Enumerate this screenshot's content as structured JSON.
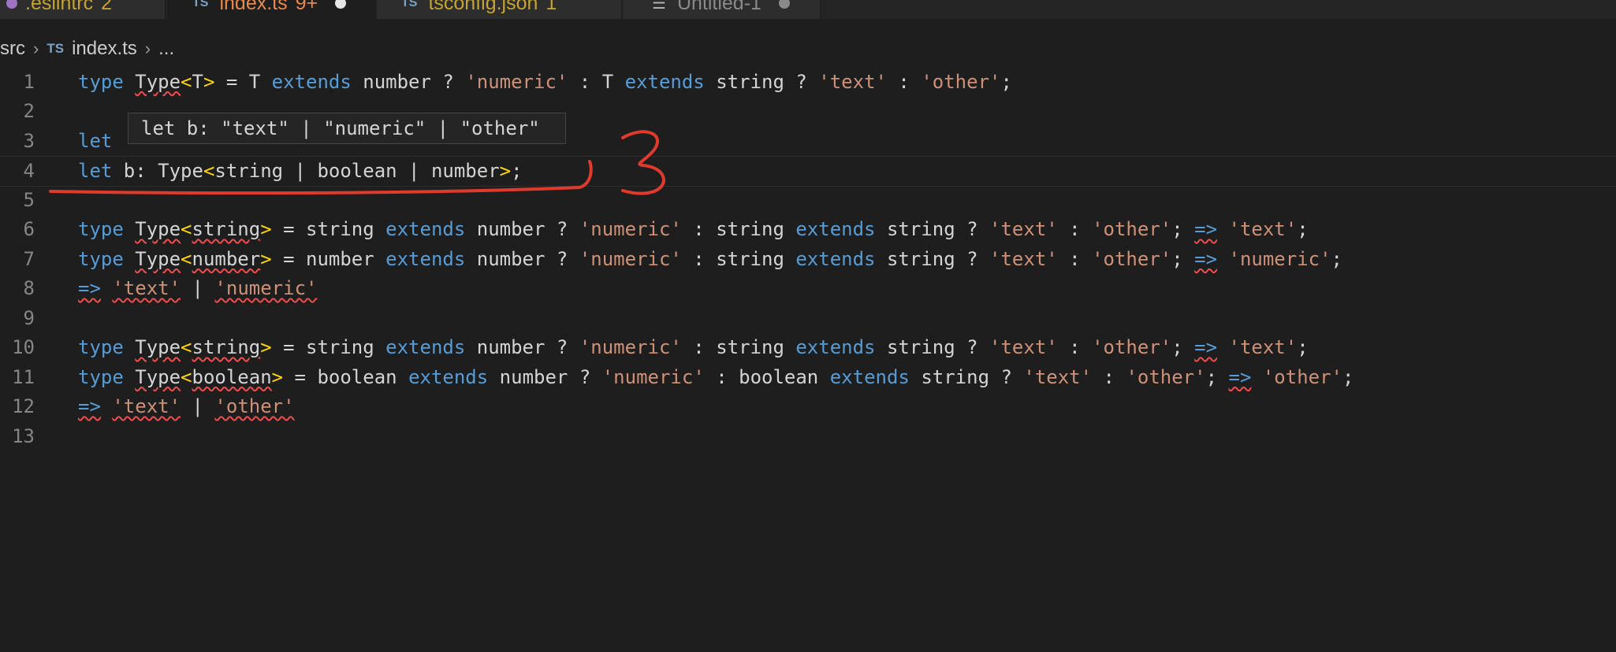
{
  "tabs": [
    {
      "name": ".eslintrc",
      "count": "2",
      "active": false
    },
    {
      "icon": "TS",
      "name": "index.ts",
      "count": "9+",
      "active": true,
      "modified": true
    },
    {
      "icon": "TS",
      "name": "tsconfig.json",
      "count": "1",
      "active": false
    },
    {
      "name": "Untitled-1",
      "active": false,
      "modified": true
    }
  ],
  "breadcrumb": {
    "folder": "src",
    "file_icon": "TS",
    "file": "index.ts",
    "more": "..."
  },
  "hover": {
    "text": "let b: \"text\" | \"numeric\" | \"other\""
  },
  "annotation": {
    "number": "3",
    "color": "#e03a2c"
  },
  "lines": [
    {
      "n": "1",
      "tokens": [
        {
          "k": "kw",
          "t": "type"
        },
        {
          "t": " "
        },
        {
          "k": "sq",
          "t": "Type"
        },
        {
          "k": "br",
          "t": "<"
        },
        {
          "t": "T"
        },
        {
          "k": "br",
          "t": ">"
        },
        {
          "t": " = T "
        },
        {
          "k": "kw",
          "t": "extends"
        },
        {
          "t": " number ? "
        },
        {
          "k": "str",
          "t": "'numeric'"
        },
        {
          "t": " : T "
        },
        {
          "k": "kw",
          "t": "extends"
        },
        {
          "t": " string ? "
        },
        {
          "k": "str",
          "t": "'text'"
        },
        {
          "t": " : "
        },
        {
          "k": "str",
          "t": "'other'"
        },
        {
          "t": ";"
        }
      ]
    },
    {
      "n": "2",
      "tokens": []
    },
    {
      "n": "3",
      "tokens": [
        {
          "k": "kw",
          "t": "let"
        }
      ]
    },
    {
      "n": "4",
      "tokens": [
        {
          "k": "kw",
          "t": "let"
        },
        {
          "t": " b: Type"
        },
        {
          "k": "br",
          "t": "<"
        },
        {
          "t": "string | boolean | number"
        },
        {
          "k": "br",
          "t": ">"
        },
        {
          "t": ";"
        }
      ]
    },
    {
      "n": "5",
      "tokens": []
    },
    {
      "n": "6",
      "tokens": [
        {
          "k": "kw",
          "t": "type"
        },
        {
          "t": " "
        },
        {
          "k": "sq",
          "t": "Type"
        },
        {
          "k": "br",
          "t": "<"
        },
        {
          "k": "sq",
          "t": "string"
        },
        {
          "k": "br",
          "t": ">"
        },
        {
          "t": " = string "
        },
        {
          "k": "kw",
          "t": "extends"
        },
        {
          "t": " number ? "
        },
        {
          "k": "str",
          "t": "'numeric'"
        },
        {
          "t": " : string "
        },
        {
          "k": "kw",
          "t": "extends"
        },
        {
          "t": " string ? "
        },
        {
          "k": "str",
          "t": "'text'"
        },
        {
          "t": " : "
        },
        {
          "k": "str",
          "t": "'other'"
        },
        {
          "t": "; "
        },
        {
          "k": "sqkw",
          "t": "=>"
        },
        {
          "t": " "
        },
        {
          "k": "str",
          "t": "'text'"
        },
        {
          "t": ";"
        }
      ]
    },
    {
      "n": "7",
      "tokens": [
        {
          "k": "kw",
          "t": "type"
        },
        {
          "t": " "
        },
        {
          "k": "sq",
          "t": "Type"
        },
        {
          "k": "br",
          "t": "<"
        },
        {
          "k": "sq",
          "t": "number"
        },
        {
          "k": "br",
          "t": ">"
        },
        {
          "t": " = number "
        },
        {
          "k": "kw",
          "t": "extends"
        },
        {
          "t": " number ? "
        },
        {
          "k": "str",
          "t": "'numeric'"
        },
        {
          "t": " : string "
        },
        {
          "k": "kw",
          "t": "extends"
        },
        {
          "t": " string ? "
        },
        {
          "k": "str",
          "t": "'text'"
        },
        {
          "t": " : "
        },
        {
          "k": "str",
          "t": "'other'"
        },
        {
          "t": "; "
        },
        {
          "k": "sqkw",
          "t": "=>"
        },
        {
          "t": " "
        },
        {
          "k": "str",
          "t": "'numeric'"
        },
        {
          "t": ";"
        }
      ]
    },
    {
      "n": "8",
      "tokens": [
        {
          "k": "sqkw",
          "t": "=>"
        },
        {
          "t": " "
        },
        {
          "k": "sqstr",
          "t": "'text'"
        },
        {
          "t": " | "
        },
        {
          "k": "sqstr",
          "t": "'numeric'"
        }
      ]
    },
    {
      "n": "9",
      "tokens": []
    },
    {
      "n": "10",
      "tokens": [
        {
          "k": "kw",
          "t": "type"
        },
        {
          "t": " "
        },
        {
          "k": "sq",
          "t": "Type"
        },
        {
          "k": "br",
          "t": "<"
        },
        {
          "k": "sq",
          "t": "string"
        },
        {
          "k": "br",
          "t": ">"
        },
        {
          "t": " = string "
        },
        {
          "k": "kw",
          "t": "extends"
        },
        {
          "t": " number ? "
        },
        {
          "k": "str",
          "t": "'numeric'"
        },
        {
          "t": " : string "
        },
        {
          "k": "kw",
          "t": "extends"
        },
        {
          "t": " string ? "
        },
        {
          "k": "str",
          "t": "'text'"
        },
        {
          "t": " : "
        },
        {
          "k": "str",
          "t": "'other'"
        },
        {
          "t": "; "
        },
        {
          "k": "sqkw",
          "t": "=>"
        },
        {
          "t": " "
        },
        {
          "k": "str",
          "t": "'text'"
        },
        {
          "t": ";"
        }
      ]
    },
    {
      "n": "11",
      "tokens": [
        {
          "k": "kw",
          "t": "type"
        },
        {
          "t": " "
        },
        {
          "k": "sq",
          "t": "Type"
        },
        {
          "k": "br",
          "t": "<"
        },
        {
          "k": "sq",
          "t": "boolean"
        },
        {
          "k": "br",
          "t": ">"
        },
        {
          "t": " = boolean "
        },
        {
          "k": "kw",
          "t": "extends"
        },
        {
          "t": " number ? "
        },
        {
          "k": "str",
          "t": "'numeric'"
        },
        {
          "t": " : boolean "
        },
        {
          "k": "kw",
          "t": "extends"
        },
        {
          "t": " string ? "
        },
        {
          "k": "str",
          "t": "'text'"
        },
        {
          "t": " : "
        },
        {
          "k": "str",
          "t": "'other'"
        },
        {
          "t": "; "
        },
        {
          "k": "sqkw",
          "t": "=>"
        },
        {
          "t": " "
        },
        {
          "k": "str",
          "t": "'other'"
        },
        {
          "t": ";"
        }
      ]
    },
    {
      "n": "12",
      "tokens": [
        {
          "k": "sqkw",
          "t": "=>"
        },
        {
          "t": " "
        },
        {
          "k": "sqstr",
          "t": "'text'"
        },
        {
          "t": " | "
        },
        {
          "k": "sqstr",
          "t": "'other'"
        }
      ]
    },
    {
      "n": "13",
      "tokens": []
    }
  ]
}
